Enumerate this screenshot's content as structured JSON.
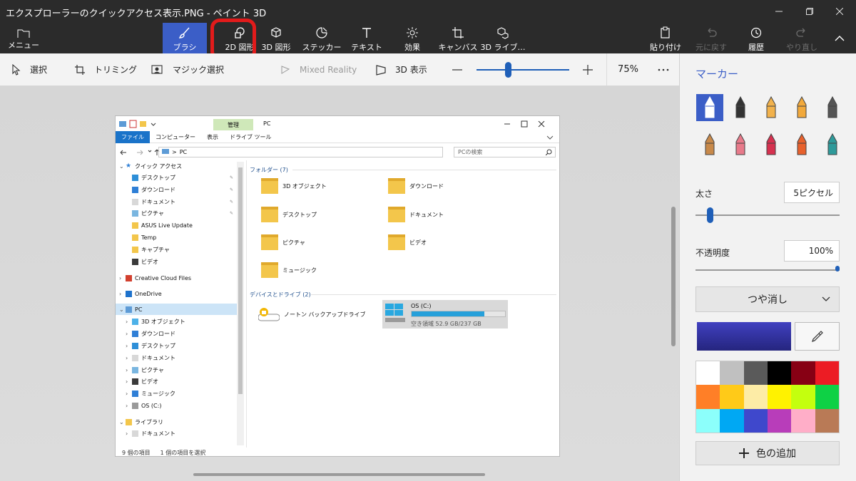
{
  "window": {
    "title": "エクスプローラーのクイックアクセス表示.PNG - ペイント 3D"
  },
  "toolbar": {
    "menu": "メニュー",
    "tools": [
      {
        "label": "ブラシ",
        "icon": "brush-icon",
        "active": true
      },
      {
        "label": "2D 図形",
        "icon": "2d-shapes-icon",
        "active": false
      },
      {
        "label": "3D 図形",
        "icon": "3d-shapes-icon",
        "active": false
      },
      {
        "label": "ステッカー",
        "icon": "stickers-icon",
        "active": false
      },
      {
        "label": "テキスト",
        "icon": "text-icon",
        "active": false
      },
      {
        "label": "効果",
        "icon": "effects-icon",
        "active": false
      },
      {
        "label": "キャンバス",
        "icon": "canvas-icon",
        "active": false
      },
      {
        "label": "3D ライブ…",
        "icon": "3d-library-icon",
        "active": false
      }
    ],
    "paste": "貼り付け",
    "undo": "元に戻す",
    "history": "履歴",
    "redo": "やり直し"
  },
  "toolrow": {
    "select": "選択",
    "crop": "トリミング",
    "magic_select": "マジック選択",
    "mixed_reality": "Mixed Reality",
    "view3d": "3D 表示",
    "zoom": "75%",
    "zoom_fraction": 0.34
  },
  "panel": {
    "title": "マーカー",
    "brushes": [
      "marker-icon",
      "calligraphy-pen-icon",
      "oil-brush-icon",
      "watercolor-icon",
      "pixel-pen-icon",
      "pencil-icon",
      "eraser-icon",
      "crayon-icon",
      "spray-can-icon",
      "fill-icon"
    ],
    "thickness_label": "太さ",
    "thickness_value": "5ピクセル",
    "thickness_fraction": 0.05,
    "opacity_label": "不透明度",
    "opacity_value": "100%",
    "opacity_fraction": 1.0,
    "finish": "つや消し",
    "current_color": "#4040c0",
    "palette": [
      "#ffffff",
      "#c0c0c0",
      "#5a5a5a",
      "#000000",
      "#870014",
      "#ec1c24",
      "#ff7f27",
      "#ffca18",
      "#fdeca6",
      "#fff200",
      "#c4ff0e",
      "#0ed145",
      "#8cfffb",
      "#00a8f3",
      "#3f48cc",
      "#b83dba",
      "#ffaec8",
      "#b97a56"
    ],
    "add_color": "色の追加"
  },
  "explorer": {
    "manage_tab": "管理",
    "title": "PC",
    "ribbon": [
      "ファイル",
      "コンピューター",
      "表示",
      "ドライブ ツール"
    ],
    "address": "PC",
    "search_placeholder": "PCの検索",
    "nav": [
      {
        "label": "クイック アクセス",
        "icon": "star-icon",
        "indent": 1,
        "expand": "v"
      },
      {
        "label": "デスクトップ",
        "icon": "desktop-icon",
        "indent": 2,
        "pin": true
      },
      {
        "label": "ダウンロード",
        "icon": "download-icon",
        "indent": 2,
        "pin": true
      },
      {
        "label": "ドキュメント",
        "icon": "document-icon",
        "indent": 2,
        "pin": true
      },
      {
        "label": "ピクチャ",
        "icon": "pictures-icon",
        "indent": 2,
        "pin": true
      },
      {
        "label": "ASUS Live Update",
        "icon": "folder-icon",
        "indent": 2
      },
      {
        "label": "Temp",
        "icon": "folder-icon",
        "indent": 2
      },
      {
        "label": "キャプチャ",
        "icon": "folder-icon",
        "indent": 2
      },
      {
        "label": "ビデオ",
        "icon": "video-icon",
        "indent": 2
      },
      {
        "label": "Creative Cloud Files",
        "icon": "creative-cloud-icon",
        "indent": 1,
        "expand": ">"
      },
      {
        "label": "OneDrive",
        "icon": "onedrive-icon",
        "indent": 1,
        "expand": ">"
      },
      {
        "label": "PC",
        "icon": "pc-icon",
        "indent": 1,
        "expand": "v",
        "selected": true
      },
      {
        "label": "3D オブジェクト",
        "icon": "3d-objects-icon",
        "indent": 2,
        "expand": ">"
      },
      {
        "label": "ダウンロード",
        "icon": "download-icon",
        "indent": 2,
        "expand": ">"
      },
      {
        "label": "デスクトップ",
        "icon": "desktop-icon",
        "indent": 2,
        "expand": ">"
      },
      {
        "label": "ドキュメント",
        "icon": "document-icon",
        "indent": 2,
        "expand": ">"
      },
      {
        "label": "ピクチャ",
        "icon": "pictures-icon",
        "indent": 2,
        "expand": ">"
      },
      {
        "label": "ビデオ",
        "icon": "video-icon",
        "indent": 2,
        "expand": ">"
      },
      {
        "label": "ミュージック",
        "icon": "music-icon",
        "indent": 2,
        "expand": ">"
      },
      {
        "label": "OS (C:)",
        "icon": "drive-icon",
        "indent": 2,
        "expand": ">"
      },
      {
        "label": "ライブラリ",
        "icon": "library-icon",
        "indent": 1,
        "expand": "v"
      },
      {
        "label": "ドキュメント",
        "icon": "document-icon",
        "indent": 2,
        "expand": ">"
      }
    ],
    "folders_group": "フォルダー (7)",
    "folders": [
      "3D オブジェクト",
      "ダウンロード",
      "デスクトップ",
      "ドキュメント",
      "ピクチャ",
      "ビデオ",
      "ミュージック"
    ],
    "drives_group": "デバイスとドライブ (2)",
    "backup_drive": "ノートン バックアップドライブ",
    "os_drive": {
      "name": "OS (C:)",
      "free_text": "空き領域 52.9 GB/237 GB",
      "used_fraction": 0.78
    },
    "status": [
      "9 個の項目",
      "1 個の項目を選択"
    ]
  }
}
